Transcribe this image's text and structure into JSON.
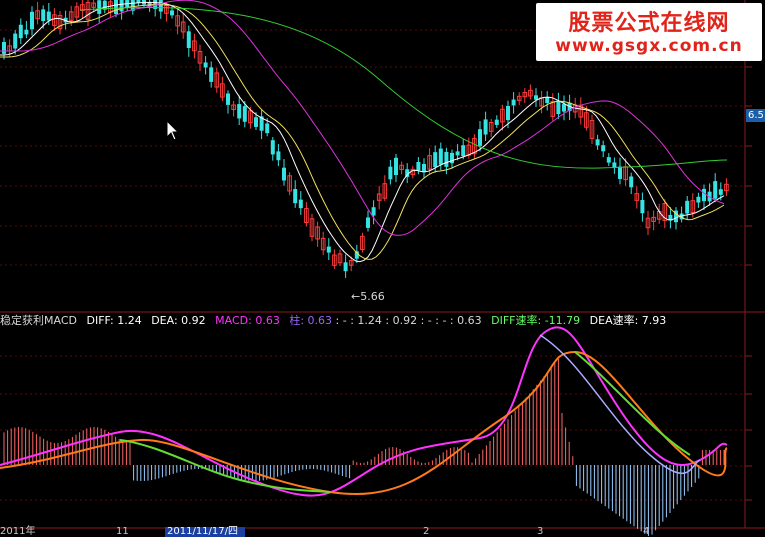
{
  "watermark": {
    "title": "股票公式在线网",
    "url": "www.gsgx.com.cn"
  },
  "price_axis": {
    "current_value": "6.5"
  },
  "price_panel": {
    "low_marker": "←5.66"
  },
  "macd_legend": {
    "name": "稳定获利MACD",
    "diff": "DIFF: 1.24",
    "dea": "DEA: 0.92",
    "macd": "MACD: 0.63",
    "zhu": "柱: 0.63",
    "sequence": ": - : 1.24 : 0.92 : - : - : 0.63",
    "diff_rate": "DIFF速率: -11.79",
    "dea_rate": "DEA速率: 7.93"
  },
  "date_axis": {
    "labels": [
      "2011年",
      "11",
      "2",
      "3",
      "4"
    ],
    "selected": "2011/11/17/四"
  },
  "colors": {
    "up": "#ff3b3b",
    "down": "#36e3e3",
    "ma_white": "#ffffff",
    "ma_yellow": "#f0e060",
    "ma_magenta": "#dd33dd",
    "ma_green": "#33cc33",
    "diff_line": "#ff33ff",
    "dea_line": "#ff7a1a",
    "hist_up": "#ff6666",
    "hist_down": "#99ccff"
  },
  "icons": [
    "mouse-cursor-icon"
  ]
}
